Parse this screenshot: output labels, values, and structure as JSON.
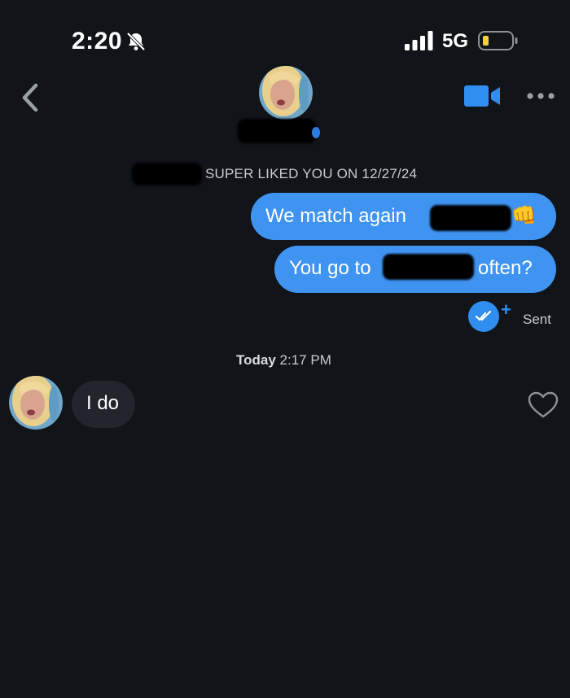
{
  "status_bar": {
    "time": "2:20",
    "network": "5G",
    "icons": [
      "bell-slash-icon",
      "signal-bars-icon",
      "battery-low-icon"
    ]
  },
  "header": {
    "back_icon": "chevron-left-icon",
    "video_icon": "video-camera-icon",
    "more_icon": "more-horizontal-icon"
  },
  "chat": {
    "superlike_notice": "SUPER LIKED YOU ON 12/27/24",
    "outgoing": [
      {
        "text_before": "We match again",
        "emoji": "👊"
      },
      {
        "text_before": "You go to",
        "text_after": "often?"
      }
    ],
    "receipt_status": "Sent",
    "date_day": "Today",
    "date_time": "2:17 PM",
    "incoming": [
      {
        "text": "I do"
      }
    ]
  },
  "colors": {
    "background": "#111418",
    "outgoing_bubble": "#3f94f2",
    "incoming_bubble": "#22262c",
    "accent": "#2f8ef0"
  }
}
